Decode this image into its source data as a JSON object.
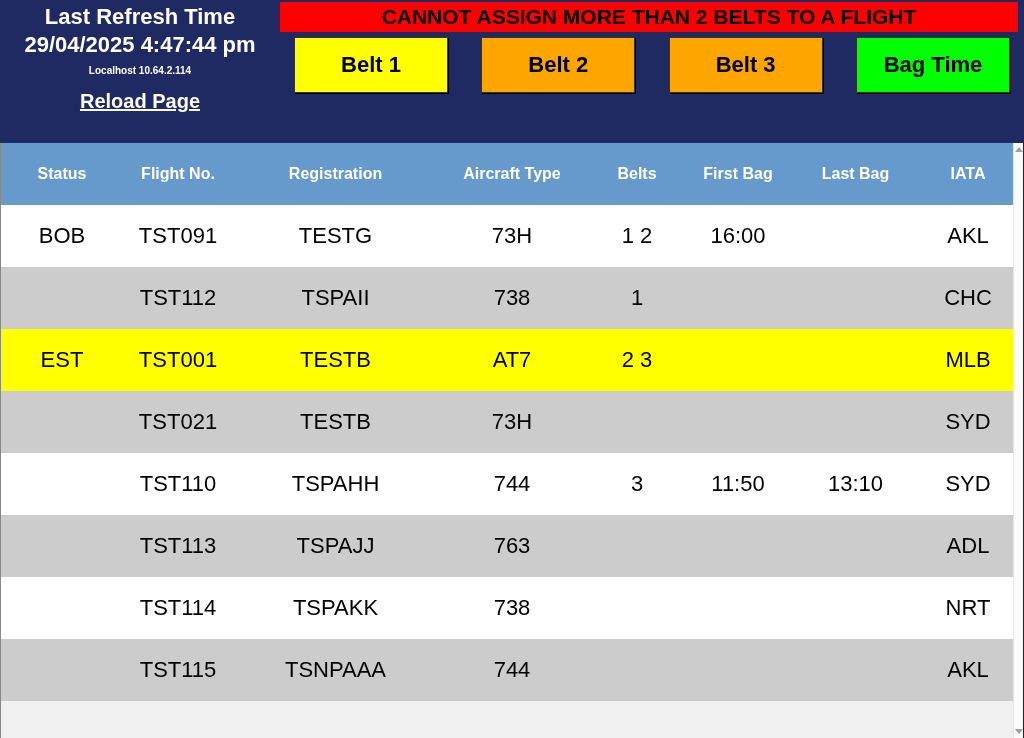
{
  "header": {
    "refresh_label": "Last Refresh Time",
    "refresh_time": "29/04/2025 4:47:44 pm",
    "host": "Localhost 10.64.2.114",
    "reload_link": "Reload Page"
  },
  "alert": "CANNOT ASSIGN MORE THAN 2 BELTS TO A FLIGHT",
  "buttons": [
    {
      "label": "Belt 1",
      "color": "#ffff00"
    },
    {
      "label": "Belt 2",
      "color": "#ffa500"
    },
    {
      "label": "Belt 3",
      "color": "#ffa500"
    },
    {
      "label": "Bag Time",
      "color": "#00ff00"
    }
  ],
  "table": {
    "columns": [
      "Status",
      "Flight No.",
      "Registration",
      "Aircraft Type",
      "Belts",
      "First Bag",
      "Last Bag",
      "IATA"
    ],
    "rows": [
      {
        "selected": false,
        "cells": [
          "BOB",
          "TST091",
          "TESTG",
          "73H",
          "1 2",
          "16:00",
          "",
          "AKL"
        ]
      },
      {
        "selected": false,
        "cells": [
          "",
          "TST112",
          "TSPAII",
          "738",
          "1",
          "",
          "",
          "CHC"
        ]
      },
      {
        "selected": true,
        "cells": [
          "EST",
          "TST001",
          "TESTB",
          "AT7",
          "2 3",
          "",
          "",
          "MLB"
        ]
      },
      {
        "selected": false,
        "cells": [
          "",
          "TST021",
          "TESTB",
          "73H",
          "",
          "",
          "",
          "SYD"
        ]
      },
      {
        "selected": false,
        "cells": [
          "",
          "TST110",
          "TSPAHH",
          "744",
          "3",
          "11:50",
          "13:10",
          "SYD"
        ]
      },
      {
        "selected": false,
        "cells": [
          "",
          "TST113",
          "TSPAJJ",
          "763",
          "",
          "",
          "",
          "ADL"
        ]
      },
      {
        "selected": false,
        "cells": [
          "",
          "TST114",
          "TSPAKK",
          "738",
          "",
          "",
          "",
          "NRT"
        ]
      },
      {
        "selected": false,
        "cells": [
          "",
          "TST115",
          "TSNPAAA",
          "744",
          "",
          "",
          "",
          "AKL"
        ]
      }
    ]
  }
}
